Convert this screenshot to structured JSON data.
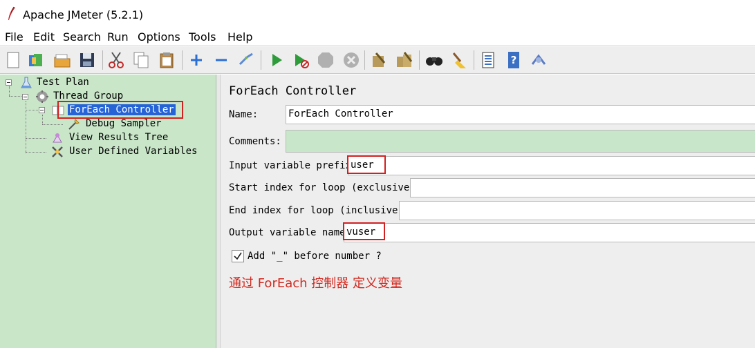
{
  "window": {
    "title": "Apache JMeter (5.2.1)"
  },
  "menu": [
    "File",
    "Edit",
    "Search",
    "Run",
    "Options",
    "Tools",
    "Help"
  ],
  "toolbar": [
    "new-icon",
    "templates-icon",
    "open-icon",
    "save-icon",
    "cut-icon",
    "copy-icon",
    "paste-icon",
    "expand-icon",
    "collapse-icon",
    "toggle-icon",
    "start-icon",
    "start-no-pause-icon",
    "stop-icon",
    "shutdown-icon",
    "clear-icon",
    "clear-all-icon",
    "search-icon",
    "reset-search-icon",
    "function-helper-icon",
    "help-icon",
    "remote-icon"
  ],
  "tree": {
    "items": [
      {
        "label": "Test Plan",
        "icon": "test-plan-icon"
      },
      {
        "label": "Thread Group",
        "icon": "thread-group-icon"
      },
      {
        "label": "ForEach Controller",
        "icon": "foreach-controller-icon",
        "selected": true
      },
      {
        "label": "Debug Sampler",
        "icon": "debug-sampler-icon"
      },
      {
        "label": "View Results Tree",
        "icon": "view-results-tree-icon"
      },
      {
        "label": "User Defined Variables",
        "icon": "user-defined-variables-icon"
      }
    ]
  },
  "editor": {
    "title": "ForEach Controller",
    "name_label": "Name:",
    "name_value": "ForEach Controller",
    "comments_label": "Comments:",
    "comments_value": "",
    "input_prefix_label": "Input variable prefix",
    "input_prefix_value": "user",
    "start_index_label": "Start index for loop (exclusive)",
    "start_index_value": "",
    "end_index_label": "End index for loop (inclusive)",
    "end_index_value": "",
    "output_name_label": "Output variable name",
    "output_name_value": "vuser",
    "add_underscore_label": "Add \"_\" before number ?",
    "add_underscore_checked": true,
    "annotation": "通过 ForEach 控制器 定义变量"
  },
  "colors": {
    "tree_bg": "#c9e6c9",
    "selection": "#2563d6",
    "highlight_box": "#d21f1f",
    "annotation_text": "#d4281e"
  }
}
